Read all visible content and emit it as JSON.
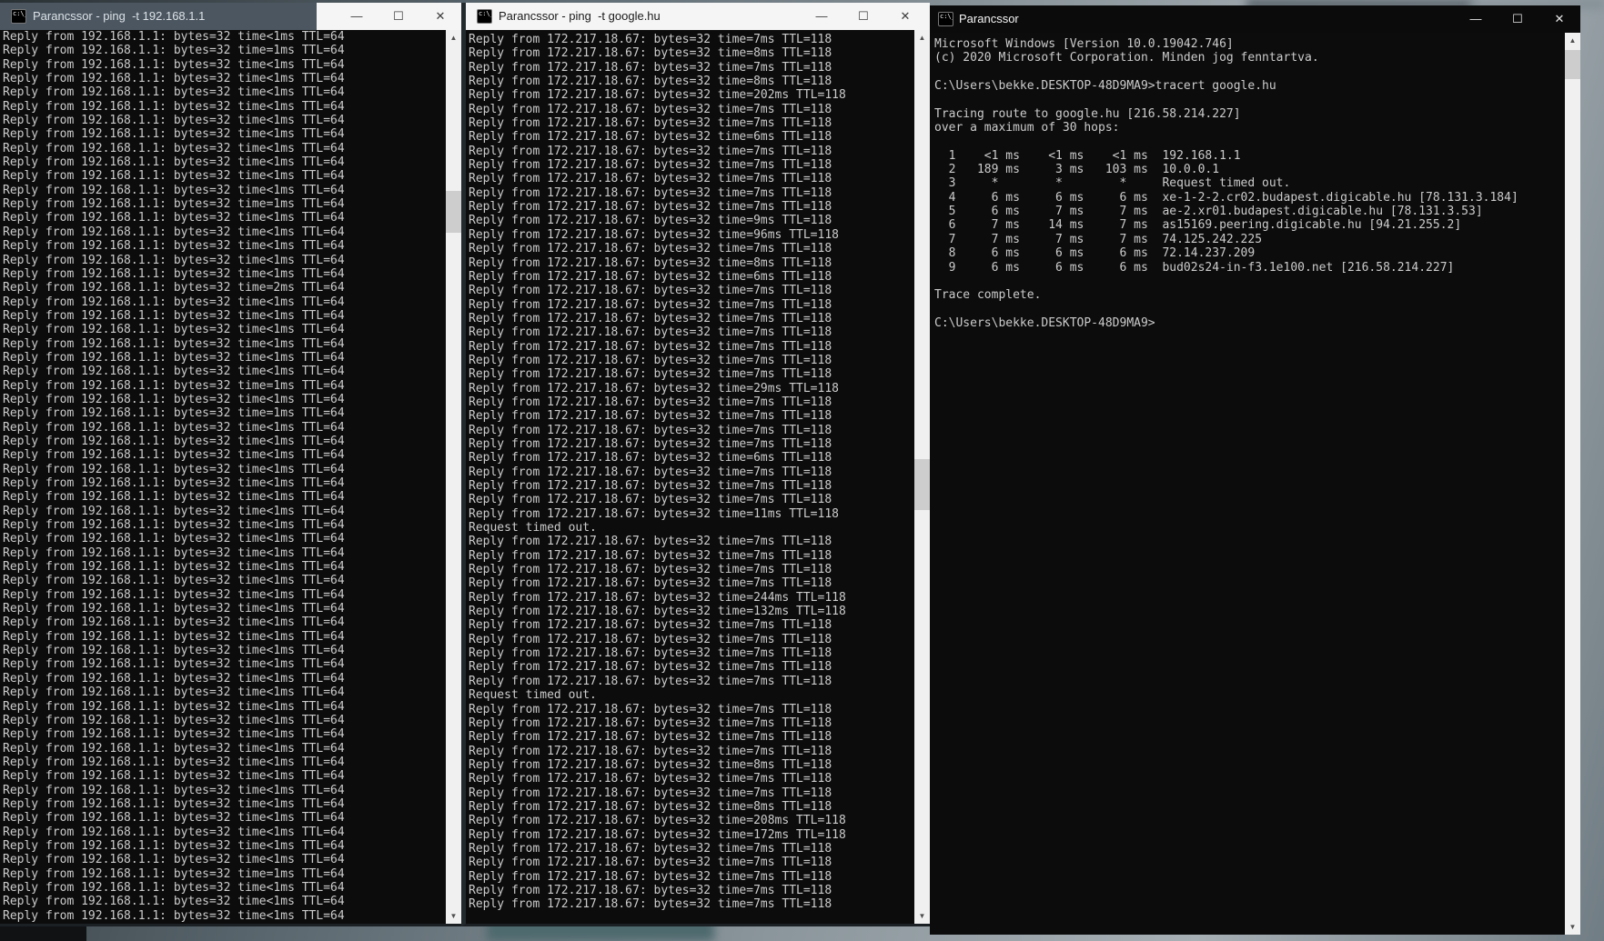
{
  "colors": {
    "console_bg": "#0c0c0c",
    "console_fg": "#cccccc",
    "left_caption_bg": "#4b5661",
    "caption_light_bg": "#f5f5f5",
    "right_caption_bg": "#0b0b0b",
    "scrollbar_track": "#f0f0f0",
    "scrollbar_thumb": "#cdcdcd",
    "scrollbar_arrow": "#4f4f4f"
  },
  "icons": {
    "cmd": "c:\\_",
    "minimize": "—",
    "maximize": "☐",
    "close": "✕",
    "scroll_up": "▲",
    "scroll_down": "▼"
  },
  "windows": {
    "left": {
      "title": "Parancssor - ping  -t 192.168.1.1",
      "console": {
        "reply_prefix": "Reply from 192.168.1.1: bytes=32 time",
        "reply_suffix": " TTL=64",
        "timeout_text": "Request timed out.",
        "times": [
          "<1ms",
          "=1ms",
          "<1ms",
          "<1ms",
          "<1ms",
          "<1ms",
          "<1ms",
          "<1ms",
          "<1ms",
          "<1ms",
          "<1ms",
          "<1ms",
          "=1ms",
          "<1ms",
          "<1ms",
          "<1ms",
          "<1ms",
          "<1ms",
          "=2ms",
          "<1ms",
          "<1ms",
          "<1ms",
          "<1ms",
          "<1ms",
          "<1ms",
          "=1ms",
          "<1ms",
          "=1ms",
          "<1ms",
          "<1ms",
          "<1ms",
          "<1ms",
          "<1ms",
          "<1ms",
          "<1ms",
          "<1ms",
          "<1ms",
          "<1ms",
          "<1ms",
          "<1ms",
          "<1ms",
          "<1ms",
          "<1ms",
          "<1ms",
          "<1ms",
          "<1ms",
          "<1ms",
          "<1ms",
          "<1ms",
          "<1ms",
          "<1ms",
          "<1ms",
          "<1ms",
          "<1ms",
          "<1ms",
          "<1ms",
          "<1ms",
          "<1ms",
          "<1ms",
          "<1ms",
          "=1ms",
          "<1ms",
          "<1ms",
          "<1ms"
        ]
      }
    },
    "middle": {
      "title": "Parancssor - ping  -t google.hu",
      "console": {
        "reply_prefix": "Reply from 172.217.18.67: bytes=32 time",
        "reply_suffix": " TTL=118",
        "timeout_text": "Request timed out.",
        "times": [
          "=7ms",
          "=8ms",
          "=7ms",
          "=8ms",
          "=202ms",
          "=7ms",
          "=7ms",
          "=6ms",
          "=7ms",
          "=7ms",
          "=7ms",
          "=7ms",
          "=7ms",
          "=9ms",
          "=96ms",
          "=7ms",
          "=8ms",
          "=6ms",
          "=7ms",
          "=7ms",
          "=7ms",
          "=7ms",
          "=7ms",
          "=7ms",
          "=7ms",
          "=29ms",
          "=7ms",
          "=7ms",
          "=7ms",
          "=7ms",
          "=6ms",
          "=7ms",
          "=7ms",
          "=7ms",
          "=11ms",
          "TIMEOUT",
          "=7ms",
          "=7ms",
          "=7ms",
          "=7ms",
          "=244ms",
          "=132ms",
          "=7ms",
          "=7ms",
          "=7ms",
          "=7ms",
          "=7ms",
          "TIMEOUT",
          "=7ms",
          "=7ms",
          "=7ms",
          "=7ms",
          "=8ms",
          "=7ms",
          "=7ms",
          "=8ms",
          "=208ms",
          "=172ms",
          "=7ms",
          "=7ms",
          "=7ms",
          "=7ms",
          "=7ms"
        ]
      }
    },
    "right": {
      "title": "Parancssor",
      "console": {
        "lines": [
          "Microsoft Windows [Version 10.0.19042.746]",
          "(c) 2020 Microsoft Corporation. Minden jog fenntartva.",
          "",
          "C:\\Users\\bekke.DESKTOP-48D9MA9>tracert google.hu",
          "",
          "Tracing route to google.hu [216.58.214.227]",
          "over a maximum of 30 hops:",
          "",
          "  1    <1 ms    <1 ms    <1 ms  192.168.1.1",
          "  2   189 ms     3 ms   103 ms  10.0.0.1",
          "  3     *        *        *     Request timed out.",
          "  4     6 ms     6 ms     6 ms  xe-1-2-2.cr02.budapest.digicable.hu [78.131.3.184]",
          "  5     6 ms     7 ms     7 ms  ae-2.xr01.budapest.digicable.hu [78.131.3.53]",
          "  6     7 ms    14 ms     7 ms  as15169.peering.digicable.hu [94.21.255.2]",
          "  7     7 ms     7 ms     7 ms  74.125.242.225",
          "  8     6 ms     6 ms     6 ms  72.14.237.209",
          "  9     6 ms     6 ms     6 ms  bud02s24-in-f3.1e100.net [216.58.214.227]",
          "",
          "Trace complete.",
          "",
          "C:\\Users\\bekke.DESKTOP-48D9MA9>"
        ]
      }
    }
  }
}
